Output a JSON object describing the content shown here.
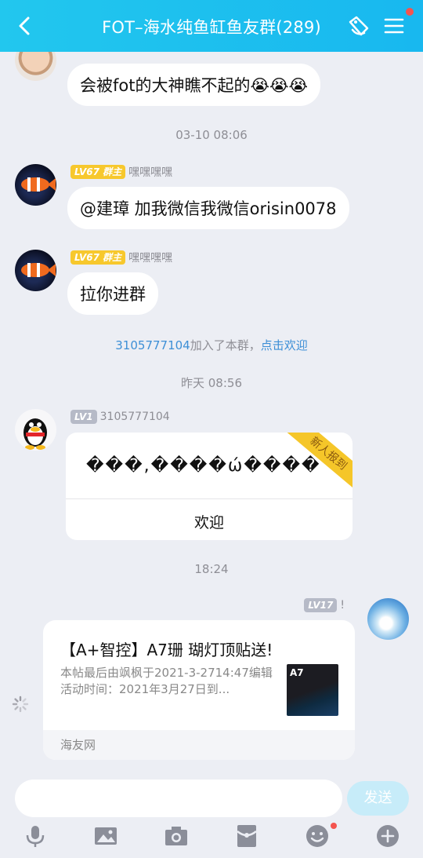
{
  "header": {
    "title": "FOT–海水纯鱼缸鱼友群(289)"
  },
  "messages": {
    "m1": {
      "text": "会被fot的大神瞧不起的😭😭😭"
    },
    "time1": "03-10 08:06",
    "m2": {
      "badge": "LV67 群主",
      "sender": "嘿嘿嘿嘿",
      "text": "@建璋 加我微信我微信orisin0078"
    },
    "m3": {
      "badge": "LV67 群主",
      "sender": "嘿嘿嘿嘿",
      "text": "拉你进群"
    },
    "system": {
      "user": "3105777104",
      "action": "加入了本群，",
      "link": "点击欢迎"
    },
    "time2": "昨天 08:56",
    "m4": {
      "badge": "LV1",
      "sender": "3105777104",
      "garbled": "���,����ώ����",
      "ribbon": "新人报到",
      "button": "欢迎"
    },
    "time3": "18:24",
    "m5": {
      "badge": "LV17",
      "sender": "!",
      "title": "【A+智控】A7珊 瑚灯顶贴送!",
      "desc": "本帖最后由飒枫于2021-3-2714:47编辑 活动时间：2021年3月27日到...",
      "thumb_text": "A7",
      "source": "海友网"
    }
  },
  "input": {
    "placeholder": "",
    "send_label": "发送"
  },
  "toolbar": {
    "icons": [
      "microphone-icon",
      "image-icon",
      "camera-icon",
      "red-packet-icon",
      "emoji-icon",
      "plus-icon"
    ]
  },
  "colors": {
    "header": "#1fc1ee",
    "badge_owner": "#f7c82d",
    "link": "#3d8fd6",
    "red_dot": "#f4544f"
  }
}
